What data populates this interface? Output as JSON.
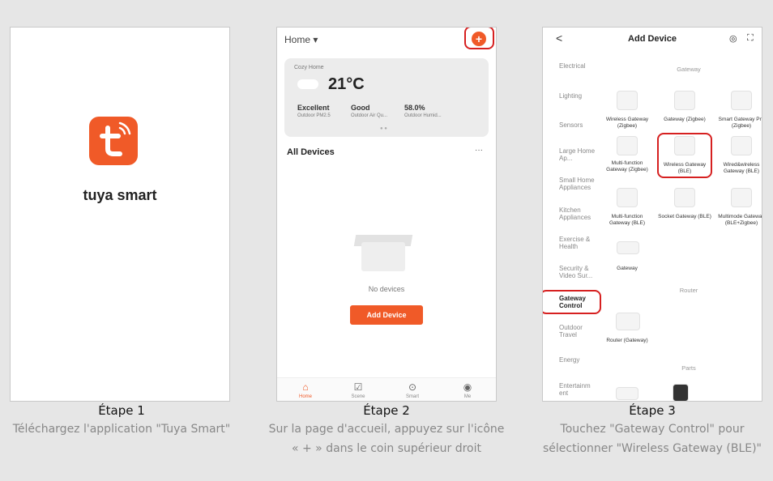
{
  "steps": [
    {
      "title": "Étape 1",
      "desc": "Téléchargez l'application \"Tuya Smart\""
    },
    {
      "title": "Étape 2",
      "desc": "Sur la page d'accueil, appuyez sur l'icône « + » dans le coin supérieur droit"
    },
    {
      "title": "Étape 3",
      "desc": "Touchez \"Gateway Control\" pour sélectionner \"Wireless Gateway (BLE)\""
    }
  ],
  "app": {
    "brand": "tuya smart",
    "logo_letter": "t",
    "accent": "#f05a28",
    "highlight": "#d62020"
  },
  "home": {
    "selector": "Home ▾",
    "plus": "+",
    "card": {
      "label": "Cozy Home",
      "temp": "21°C",
      "stats": [
        {
          "value": "Excellent",
          "label": "Outdoor PM2.5"
        },
        {
          "value": "Good",
          "label": "Outdoor Air Qu..."
        },
        {
          "value": "58.0%",
          "label": "Outdoor Humid..."
        }
      ],
      "pager": "● ●"
    },
    "all_devices": "All Devices",
    "more": "···",
    "empty": "No devices",
    "add_button": "Add Device",
    "tabs": [
      {
        "icon": "home-icon",
        "glyph": "⌂",
        "label": "Home"
      },
      {
        "icon": "scene-icon",
        "glyph": "☑",
        "label": "Scene"
      },
      {
        "icon": "smart-icon",
        "glyph": "⊙",
        "label": "Smart"
      },
      {
        "icon": "me-icon",
        "glyph": "◉",
        "label": "Me"
      }
    ]
  },
  "add_device": {
    "back": "<",
    "title": "Add Device",
    "icons": [
      "◎",
      "⛶"
    ],
    "categories": [
      "Electrical",
      "Lighting",
      "Sensors",
      "Large Home Ap...",
      "Small Home Appliances",
      "Kitchen Appliances",
      "Exercise & Health",
      "Security & Video Sur...",
      "Gateway Control",
      "Outdoor Travel",
      "Energy",
      "Entertainm ent"
    ],
    "sections": {
      "gateway": "Gateway",
      "router": "Router",
      "parts": "Parts"
    },
    "gateway_devices": [
      "Wireless Gateway (Zigbee)",
      "Gateway (Zigbee)",
      "Smart Gateway Pro (Zigbee)",
      "Multi-function Gateway (Zigbee)",
      "Wireless Gateway (BLE)",
      "Wired&wireless Gateway (BLE)",
      "Multi-function Gateway (BLE)",
      "Socket Gateway (BLE)",
      "Multimode Gateway (BLE+Zigbee)",
      "Gateway"
    ],
    "router_devices": [
      "Router (Gateway)"
    ]
  }
}
